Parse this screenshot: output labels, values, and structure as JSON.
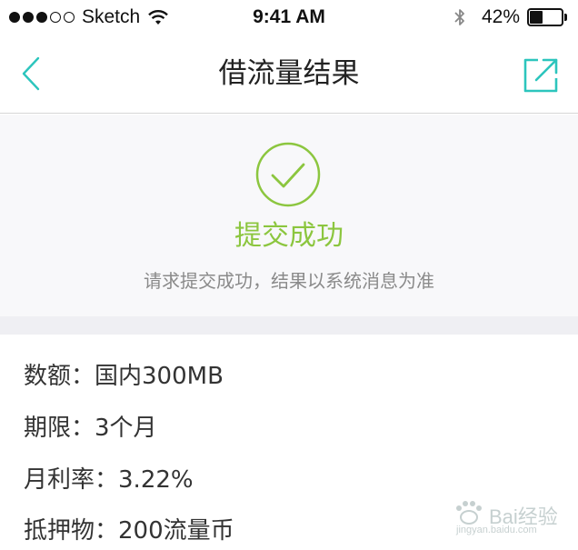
{
  "status_bar": {
    "carrier": "Sketch",
    "time": "9:41 AM",
    "battery_percent": "42%",
    "battery_level": 0.42,
    "signal_bars": 3
  },
  "nav": {
    "title": "借流量结果",
    "back_icon": "chevron-left-icon",
    "share_icon": "share-icon",
    "accent_color": "#2cc5bd"
  },
  "result": {
    "title": "提交成功",
    "description": "请求提交成功，结果以系统消息为准",
    "status_color": "#8cc63f"
  },
  "details": [
    {
      "label": "数额：",
      "value": "国内300MB"
    },
    {
      "label": "期限：",
      "value": "3个月"
    },
    {
      "label": "月利率：",
      "value": "3.22%"
    },
    {
      "label": "抵押物：",
      "value": "200流量币"
    }
  ],
  "watermark": {
    "brand": "Bai",
    "brand2": "经验",
    "url": "jingyan.baidu.com"
  }
}
